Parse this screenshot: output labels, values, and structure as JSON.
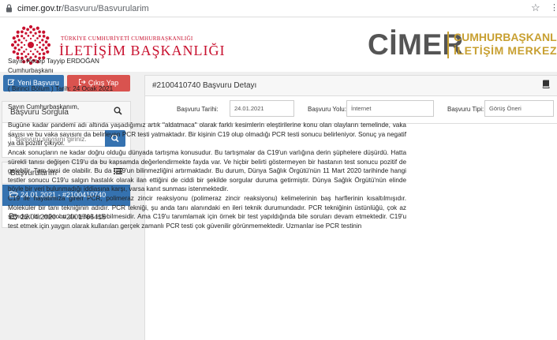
{
  "browser": {
    "url_host": "cimer.gov.tr",
    "url_path": "/Basvuru/Basvurularim"
  },
  "header": {
    "left_small": "TÜRKİYE CUMHURİYETİ CUMHURBAŞKANLIĞI",
    "left_big": "İLETİŞİM BAŞKANLIĞI",
    "cimer": "CİMER",
    "right_line1": "CUMHURBAŞKANLIĞI",
    "right_line2": "İLETİŞİM MERKEZİ"
  },
  "sidebar": {
    "new_button": "Yeni Başvuru",
    "exit_button": "Çıkış Yap",
    "query_title": "Başvuru Sorgula",
    "query_placeholder": "Başvuru sayısını giriniz.",
    "list_title": "Başvurularım",
    "items": [
      {
        "label": "24.01.2021 - #2100410740",
        "active": true
      },
      {
        "label": "22.04.2020 - #2001766415",
        "active": false
      }
    ]
  },
  "main": {
    "title": "#2100410740 Başvuru Detayı",
    "date_label": "Başvuru Tarihi:",
    "date_value": "24.01.2021",
    "channel_label": "Başvuru Yolu:",
    "channel_value": "İnternet",
    "type_label": "Başvuru Tipi:",
    "type_value": "Görüş Öneri",
    "recipient_name": "Sayın Recep Tayyip ERDOĞAN",
    "recipient_title": "Cumhurbaşkanı",
    "part_line": "( Birinci Bölüm ) Tarih: 24 Ocak 2021",
    "salutation": "Sayın Cumhurbaşkanım,",
    "para1": "Bugüne kadar pandemi adı altında yaşadığımız artık \"aldatmaca\" olarak farklı kesimlerin eleştirilerine konu olan olayların temelinde, vaka sayısı ve bu vaka sayısını da belirleyen PCR testi yatmaktadır. Bir kişinin C19 olup olmadığı PCR testi sonucu belirleniyor. Sonuç ya negatif ya da pozitif çıkıyor.",
    "para2": "Ancak sonuçların ne kadar doğru olduğu dünyada tartışma konusudur. Bu tartışmalar da C19'un varlığına derin şüphelere düşürdü. Hatta sürekli tanısı değişen C19'u da bu kapsamda değerlendirmekte fayda var. Ve hiçbir belirti göstermeyen bir hastanın test sonucu pozitif de gelebilir. Tam tersi de olabilir. Bu da C19'un bilinmezliğini artırmaktadır. Bu durum, Dünya Sağlık Örgütü'nün 11 Mart 2020 tarihinde hangi testler sonucu C19'u salgın hastalık olarak ilan ettiğini de ciddi bir şekilde sorgular duruma getirmiştir. Dünya Sağlık Örgütü'nün elinde böyle bir veri bulunmadığı iddiasına karşı, varsa kanıt sunması istenmektedir.",
    "para3": "C19 ile hayatımıza giren PCR, polimeraz zincir reaksiyonu (polimeraz zincir reaksiyonu) kelimelerinin baş harflerinin kısaltılmışıdır. Moleküler bir tanı tekniğinin adıdır. PCR tekniği, şu anda tanı alanındaki en ileri teknik durumundadır. PCR tekniğinin üstünlüğü, çok az sayıdaki bir mikrobu da tespit edebilmesidir. Ama C19'u tanımlamak için örnek bir test yapıldığında bile soruları devam etmektedir. C19'u test etmek için yaygın olarak kullanılan gerçek zamanlı PCR testi çok güvenilir görünmemektedir. Uzmanlar ise PCR testinin"
  },
  "colors": {
    "primary": "#3572b0",
    "danger": "#d9534f",
    "brand_red": "#c8102e",
    "brand_gold": "#c8a032"
  }
}
